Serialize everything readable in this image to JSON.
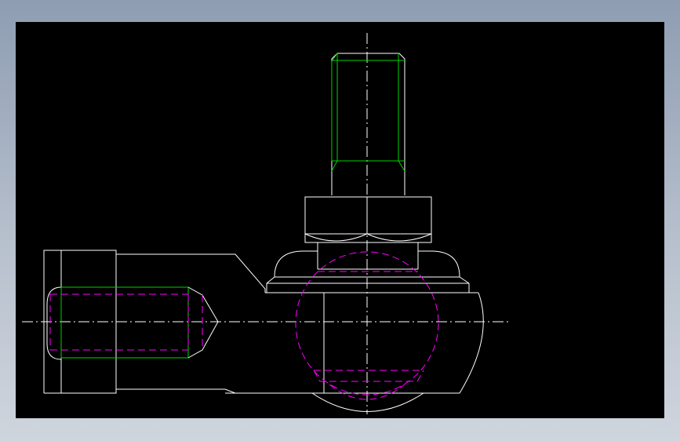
{
  "drawing": {
    "title": "",
    "background": "#000000",
    "colors": {
      "outline": "#ffffff",
      "thread": "#00d200",
      "hidden": "#ff00ff",
      "centerline": "#ffffff"
    }
  }
}
